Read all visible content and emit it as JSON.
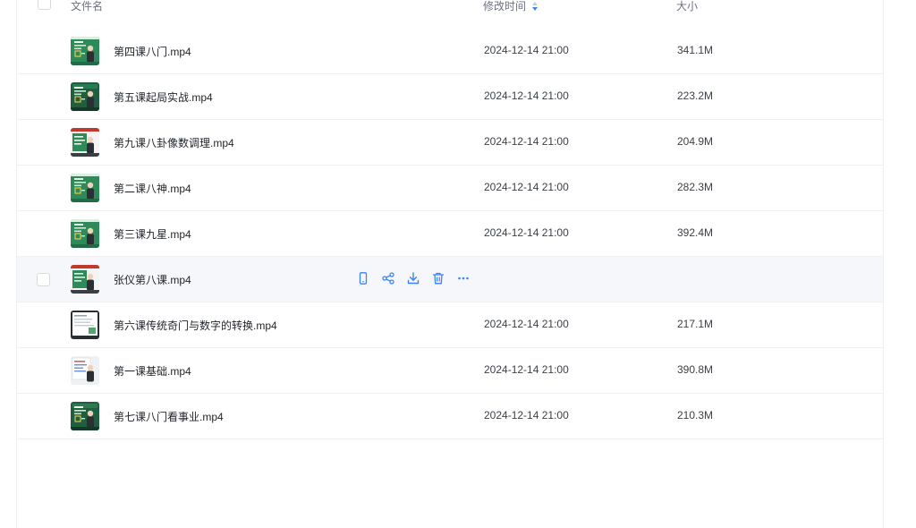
{
  "header": {
    "name_label": "文件名",
    "time_label": "修改时间",
    "size_label": "大小"
  },
  "colors": {
    "accent": "#3b82f6",
    "row_hover": "#f5f7fa",
    "thumb_green": "#2e8b57"
  },
  "files": [
    {
      "name": "第四课八门.mp4",
      "time": "2024-12-14 21:00",
      "size": "341.1M",
      "thumb": "green-board"
    },
    {
      "name": "第五课起局实战.mp4",
      "time": "2024-12-14 21:00",
      "size": "223.2M",
      "thumb": "dark-green-board"
    },
    {
      "name": "第九课八卦像数调理.mp4",
      "time": "2024-12-14 21:00",
      "size": "204.9M",
      "thumb": "slides-board"
    },
    {
      "name": "第二课八神.mp4",
      "time": "2024-12-14 21:00",
      "size": "282.3M",
      "thumb": "green-board"
    },
    {
      "name": "第三课九星.mp4",
      "time": "2024-12-14 21:00",
      "size": "392.4M",
      "thumb": "green-board"
    },
    {
      "name": "张仪第八课.mp4",
      "time": "",
      "size": "",
      "thumb": "slides-board",
      "hover": true,
      "actions": [
        "mobile-icon",
        "share-icon",
        "download-icon",
        "delete-icon",
        "more-icon"
      ]
    },
    {
      "name": "第六课传统奇门与数字的转换.mp4",
      "time": "2024-12-14 21:00",
      "size": "217.1M",
      "thumb": "white-slides"
    },
    {
      "name": "第一课基础.mp4",
      "time": "2024-12-14 21:00",
      "size": "390.8M",
      "thumb": "white-board"
    },
    {
      "name": "第七课八门看事业.mp4",
      "time": "2024-12-14 21:00",
      "size": "210.3M",
      "thumb": "dark-green-board"
    }
  ]
}
